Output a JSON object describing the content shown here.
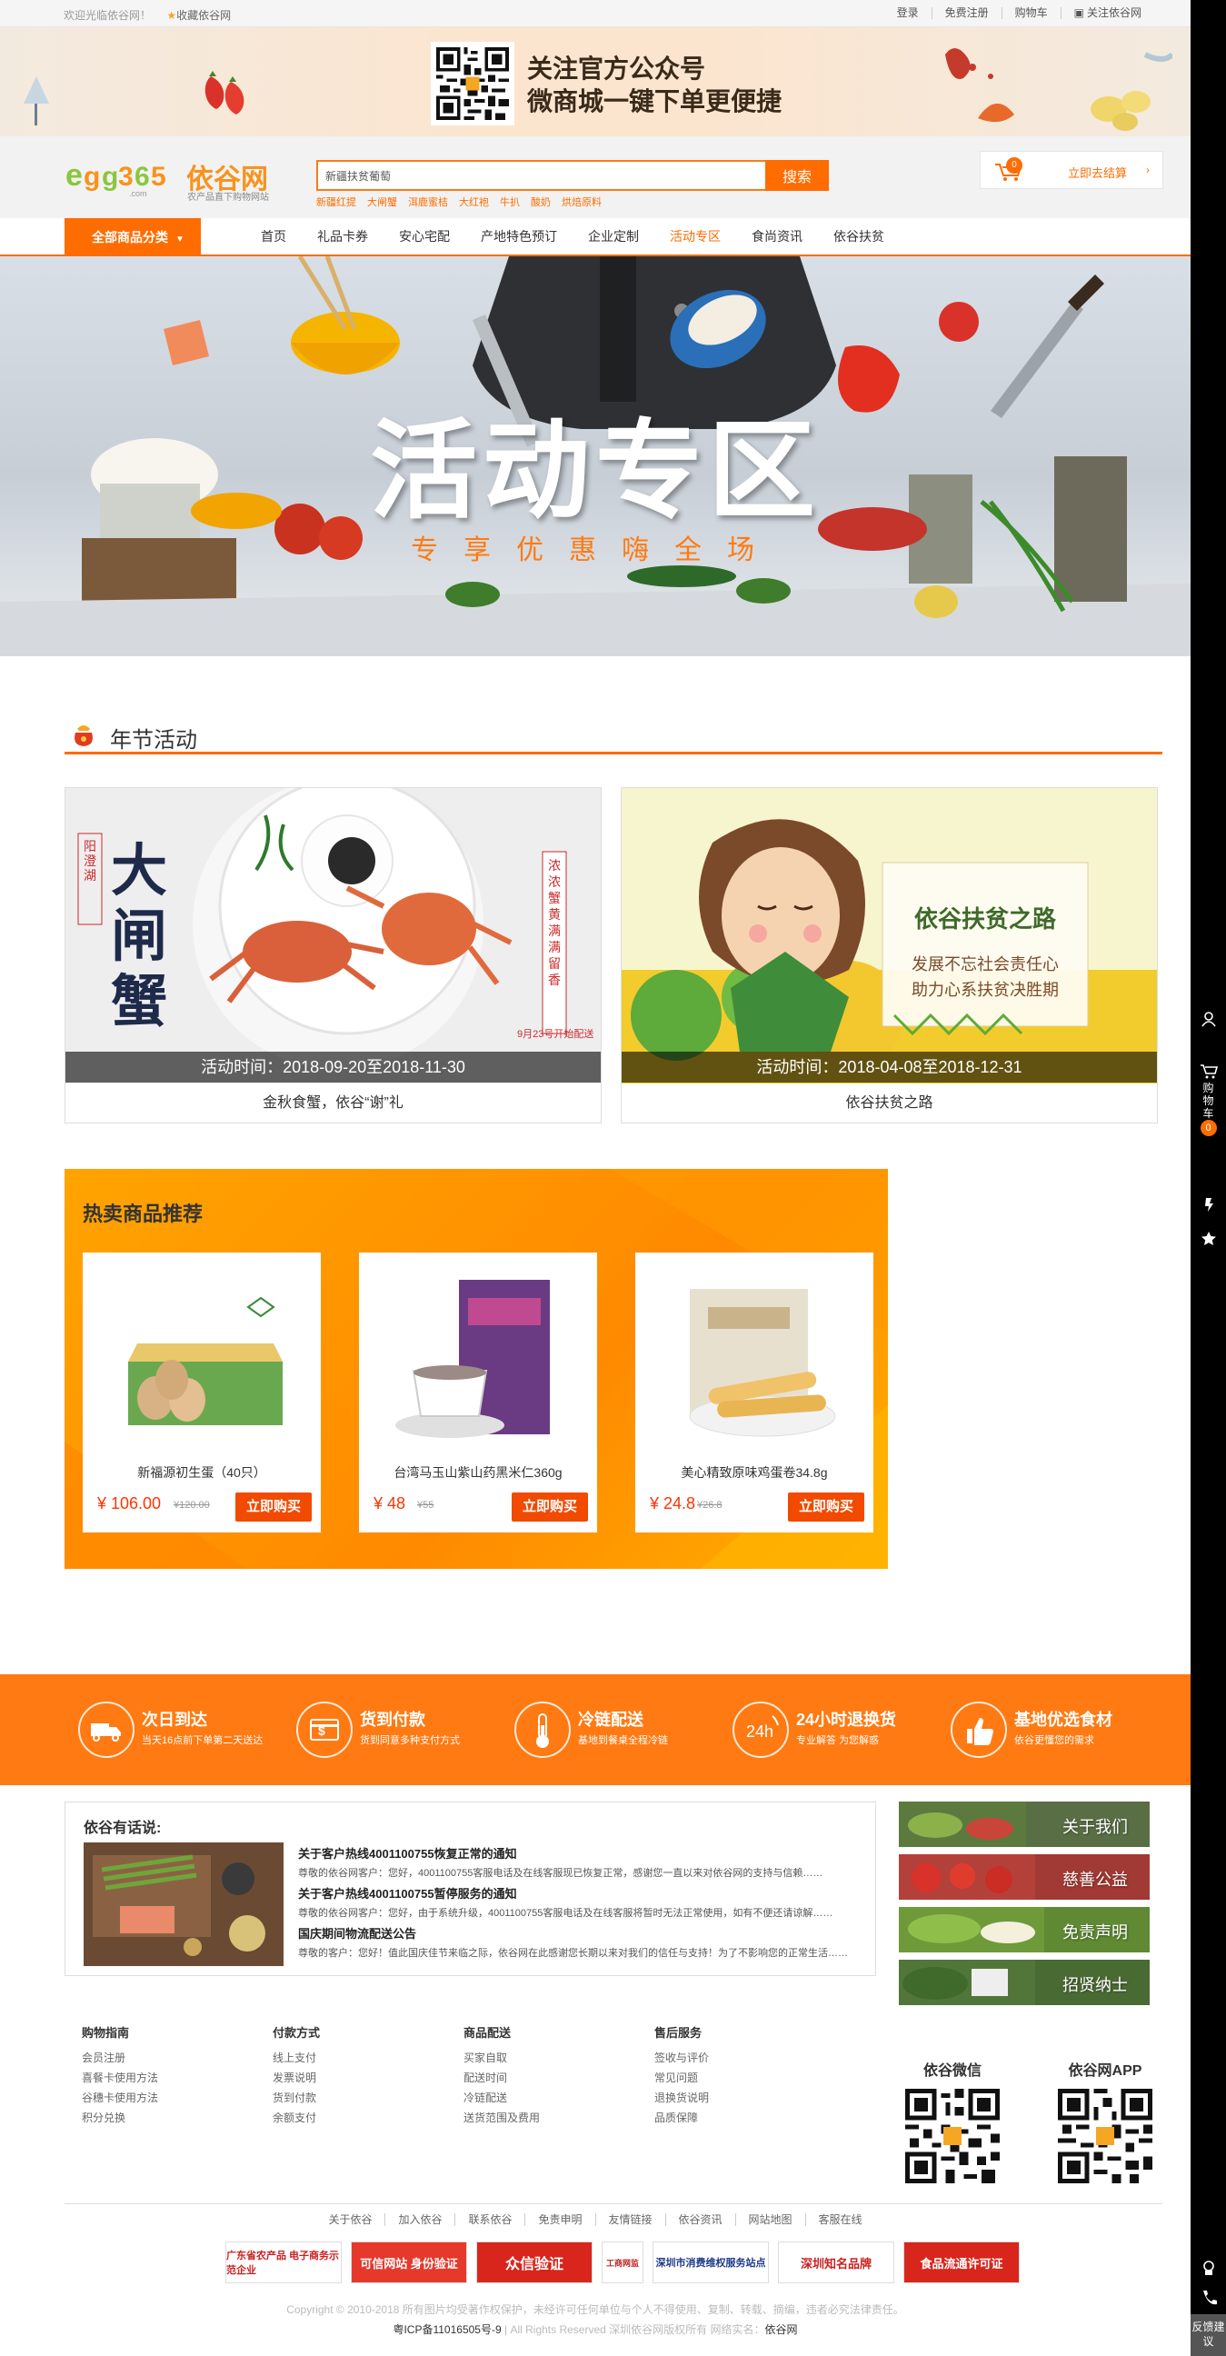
{
  "topbar": {
    "welcome": "欢迎光临依谷网！",
    "favorite": "收藏依谷网",
    "links": [
      "登录",
      "免费注册",
      "购物车",
      "关注依谷网"
    ]
  },
  "promo": {
    "line1": "关注官方公众号",
    "line2": "微商城一键下单更便捷"
  },
  "header": {
    "logo_text": "依谷网",
    "logo_tagline": "农产品直下购物网站",
    "search_value": "新疆扶贫葡萄",
    "search_button": "搜索",
    "hotwords": [
      "新疆红提",
      "大闸蟹",
      "洱鹿蜜桔",
      "大红袍",
      "牛扒",
      "酸奶",
      "烘焙原料"
    ],
    "cart_count": "0",
    "cart_label": "立即去结算",
    "cart_arrow": "›"
  },
  "nav": {
    "all_categories": "全部商品分类",
    "items": [
      "首页",
      "礼品卡券",
      "安心宅配",
      "产地特色预订",
      "企业定制",
      "活动专区",
      "食尚资讯",
      "依谷扶贫"
    ],
    "active_index": 5
  },
  "hero": {
    "title": "活动专区",
    "subtitle": "专享优惠嗨全场"
  },
  "section": {
    "title": "年节活动"
  },
  "activities": [
    {
      "poster_big": "大闸蟹",
      "poster_tag": "阳澄湖",
      "poster_side": "浓浓蟹黄 满满留香",
      "poster_note": "9月23号开始配送",
      "time": "活动时间：2018-09-20至2018-11-30",
      "name": "金秋食蟹，依谷“谢”礼"
    },
    {
      "poster_big": "依谷扶贫之路",
      "poster_line1": "发展不忘社会责任心",
      "poster_line2": "助力心系扶贫决胜期",
      "time": "活动时间：2018-04-08至2018-12-31",
      "name": "依谷扶贫之路"
    }
  ],
  "hot": {
    "title": "热卖商品推荐",
    "buy_label": "立即购买",
    "products": [
      {
        "name": "新福源初生蛋（40只）",
        "price": "¥ 106.00",
        "old_price": "¥120.00",
        "icon": "egg-box"
      },
      {
        "name": "台湾马玉山紫山药黑米仁360g",
        "price": "¥ 48",
        "old_price": "¥55",
        "icon": "black-rice-drink"
      },
      {
        "name": "美心精致原味鸡蛋卷34.8g",
        "price": "¥ 24.8",
        "old_price": "¥26.8",
        "icon": "egg-rolls"
      }
    ]
  },
  "services": [
    {
      "title": "次日到达",
      "desc": "当天16点前下单第二天送达",
      "icon": "truck-icon"
    },
    {
      "title": "货到付款",
      "desc": "货到同意多种支付方式",
      "icon": "card-icon"
    },
    {
      "title": "冷链配送",
      "desc": "基地到餐桌全程冷链",
      "icon": "thermometer-icon"
    },
    {
      "title": "24小时退换货",
      "desc": "专业解答 为您解惑",
      "icon": "24h-icon"
    },
    {
      "title": "基地优选食材",
      "desc": "依谷更懂您的需求",
      "icon": "thumbs-up-icon"
    }
  ],
  "news": {
    "title": "依谷有话说:",
    "items": [
      {
        "head": "关于客户热线4001100755恢复正常的通知",
        "body": "尊敬的依谷网客户：您好，4001100755客服电话及在线客服现已恢复正常，感谢您一直以来对依谷网的支持与信赖……"
      },
      {
        "head": "关于客户热线4001100755暂停服务的通知",
        "body": "尊敬的依谷网客户：您好，由于系统升级，4001100755客服电话及在线客服将暂时无法正常使用，如有不便还请谅解……"
      },
      {
        "head": "国庆期间物流配送公告",
        "body": "尊敬的客户：您好！值此国庆佳节来临之际，依谷网在此感谢您长期以来对我们的信任与支持！为了不影响您的正常生活……"
      }
    ]
  },
  "side_links": [
    "关于我们",
    "慈善公益",
    "免责声明",
    "招贤纳士"
  ],
  "footer": {
    "columns": [
      {
        "head": "购物指南",
        "items": [
          "会员注册",
          "喜餐卡使用方法",
          "谷穗卡使用方法",
          "积分兑换"
        ]
      },
      {
        "head": "付款方式",
        "items": [
          "线上支付",
          "发票说明",
          "货到付款",
          "余额支付"
        ]
      },
      {
        "head": "商品配送",
        "items": [
          "买家自取",
          "配送时间",
          "冷链配送",
          "送货范围及费用"
        ]
      },
      {
        "head": "售后服务",
        "items": [
          "签收与评价",
          "常见问题",
          "退换货说明",
          "品质保障"
        ]
      }
    ],
    "qr_wechat": "依谷微信",
    "qr_app": "依谷网APP",
    "links": [
      "关于依谷",
      "加入依谷",
      "联系依谷",
      "免责申明",
      "友情链接",
      "依谷资讯",
      "网站地图",
      "客服在线"
    ],
    "badges": [
      "广东省农产品 电子商务示范企业",
      "可信网站 身份验证",
      "众信验证",
      "工商网监",
      "深圳市消费维权服务站点",
      "深圳知名品牌",
      "食品流通许可证"
    ],
    "copyright": "Copyright © 2010-2018 所有图片均受著作权保护，未经许可任何单位与个人不得使用、复制、转载、摘编，违者必究法律责任。",
    "icp_prefix": "粤ICP备11016505号-9",
    "icp_rest": " | All Rights Reserved 深圳依谷网版权所有 网络实名：",
    "icp_name": "依谷网"
  },
  "right_sidebar": {
    "cart_label": "购物车",
    "cart_count": "0",
    "feedback": "反馈建议"
  },
  "colors": {
    "accent": "#ff6c00",
    "orange_bar": "#ff7a12",
    "hot_bg": "#ffa400"
  }
}
